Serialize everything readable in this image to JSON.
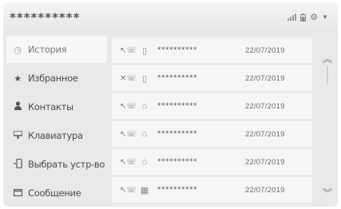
{
  "header": {
    "title": "**********",
    "status_icons": [
      "signal-icon",
      "battery-icon",
      "gear-icon",
      "dropdown-arrow-icon"
    ]
  },
  "sidebar": {
    "items": [
      {
        "label": "История",
        "icon": "clock-icon",
        "active": true
      },
      {
        "label": "Избранное",
        "icon": "star-icon",
        "active": false
      },
      {
        "label": "Контакты",
        "icon": "person-icon",
        "active": false
      },
      {
        "label": "Клавиатура",
        "icon": "keypad-icon",
        "active": false
      },
      {
        "label": "Выбрать устр-во",
        "icon": "device-select-icon",
        "active": false
      },
      {
        "label": "Сообщение",
        "icon": "message-icon",
        "active": false
      }
    ]
  },
  "calls": [
    {
      "call_type": "outgoing",
      "device": "mobile",
      "name": "**********",
      "date": "22/07/2019"
    },
    {
      "call_type": "missed",
      "device": "mobile",
      "name": "**********",
      "date": "22/07/2019"
    },
    {
      "call_type": "outgoing",
      "device": "home",
      "name": "**********",
      "date": "22/07/2019"
    },
    {
      "call_type": "outgoing",
      "device": "home",
      "name": "**********",
      "date": "22/07/2019"
    },
    {
      "call_type": "outgoing",
      "device": "home",
      "name": "**********",
      "date": "22/07/2019"
    },
    {
      "call_type": "outgoing",
      "device": "office",
      "name": "**********",
      "date": "22/07/2019"
    }
  ],
  "scroll": {
    "up_icon": "chevron-up-icon",
    "down_icon": "chevron-down-icon"
  }
}
